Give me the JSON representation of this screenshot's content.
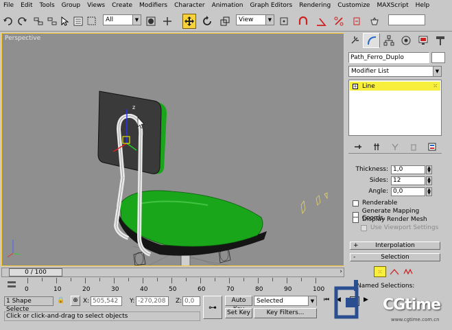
{
  "menu": [
    "File",
    "Edit",
    "Tools",
    "Group",
    "Views",
    "Create",
    "Modifiers",
    "Character",
    "Animation",
    "Graph Editors",
    "Rendering",
    "Customize",
    "MAXScript",
    "Help"
  ],
  "toolbar": {
    "selection_filter": "All",
    "reference_coord": "View"
  },
  "viewport": {
    "label": "Perspective",
    "gizmo_axis_label": "z"
  },
  "command_panel": {
    "object_name": "Path_Ferro_Duplo",
    "modifier_list": "Modifier List",
    "stack_item": "Line",
    "rendering": {
      "thickness_label": "Thickness:",
      "thickness_value": "1,0",
      "sides_label": "Sides:",
      "sides_value": "12",
      "angle_label": "Angle:",
      "angle_value": "0,0",
      "renderable": "Renderable",
      "generate_mapping": "Generate Mapping Coords.",
      "display_render_mesh": "Display Render Mesh",
      "use_viewport_settings": "Use Viewport Settings"
    },
    "interpolation": "Interpolation",
    "selection": "Selection",
    "named_selections": "Named Selections:"
  },
  "timeline": {
    "frame_display": "0 / 100",
    "ticks": [
      "0",
      "10",
      "20",
      "30",
      "40",
      "50",
      "60",
      "70",
      "80",
      "90",
      "100"
    ]
  },
  "status": {
    "selection_count": "1 Shape Selecte",
    "x_label": "X:",
    "x_value": "505,542",
    "y_label": "Y:",
    "y_value": "-270,208",
    "z_label": "Z:",
    "z_value": "0,0",
    "auto_key": "Auto Key",
    "set_key": "Set Key",
    "key_mode": "Selected",
    "key_filters": "Key Filters...",
    "prompt": "Click or click-and-drag to select objects"
  },
  "watermark": {
    "brand": "CGtime",
    "url": "www.cgtime.com.cn"
  },
  "colors": {
    "active_yellow": "#f7d23a",
    "seat_green": "#1aa61a",
    "viewport_gray": "#8f8f8f"
  }
}
